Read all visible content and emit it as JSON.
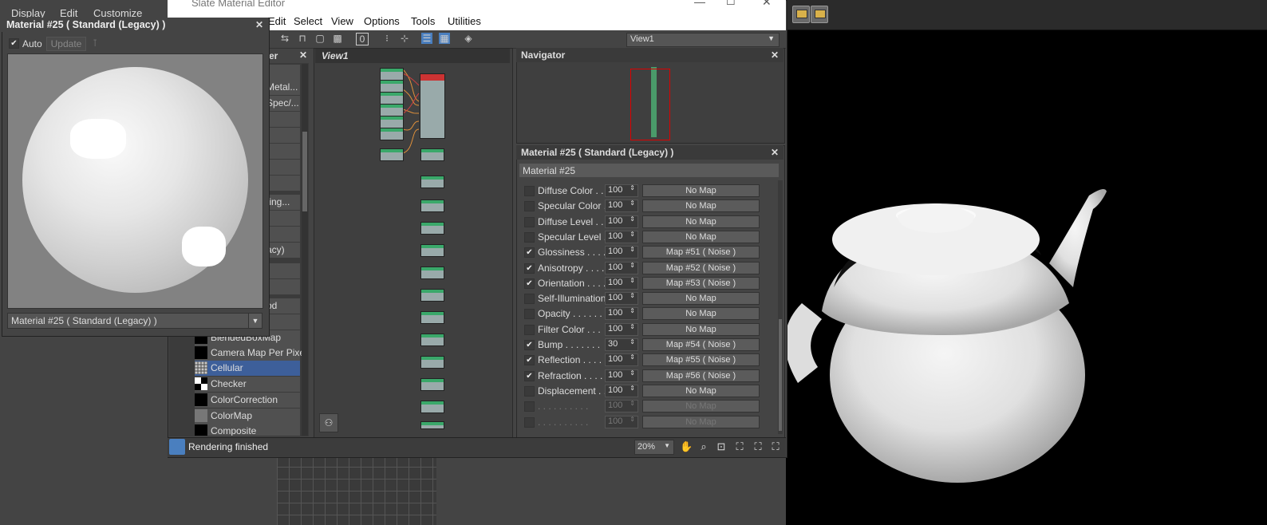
{
  "main_menu": {
    "display": "Display",
    "edit": "Edit",
    "customize": "Customize"
  },
  "slate": {
    "title": "Slate Material Editor",
    "menu": {
      "edit": "Edit",
      "select": "Select",
      "view": "View",
      "options": "Options",
      "tools": "Tools",
      "utilities": "Utilities"
    },
    "view_select": "View1",
    "view_tab": "View1",
    "browser_partial": [
      "er",
      "Metal...",
      "Spec/...",
      "ting...",
      "acy)",
      "od"
    ],
    "browser_items": [
      {
        "label": "BlendedBoxMap",
        "swatch": "#000000"
      },
      {
        "label": "Camera Map Per Pixel",
        "swatch": "#000000"
      },
      {
        "label": "Cellular",
        "swatch": "#888888",
        "selected": true
      },
      {
        "label": "Checker",
        "swatch": "checker"
      },
      {
        "label": "ColorCorrection",
        "swatch": "#000000"
      },
      {
        "label": "ColorMap",
        "swatch": "#777777"
      },
      {
        "label": "Composite",
        "swatch": "#000000"
      }
    ],
    "navigator_title": "Navigator",
    "status": "Rendering finished",
    "zoom": "20%"
  },
  "material": {
    "panel_title": "Material #25  ( Standard (Legacy) )",
    "name": "Material #25",
    "maps": [
      {
        "label": "Diffuse Color . . .",
        "checked": false,
        "amount": "100",
        "map": "No Map"
      },
      {
        "label": "Specular Color  .",
        "checked": false,
        "amount": "100",
        "map": "No Map"
      },
      {
        "label": "Diffuse Level . . .",
        "checked": false,
        "amount": "100",
        "map": "No Map"
      },
      {
        "label": "Specular Level  .",
        "checked": false,
        "amount": "100",
        "map": "No Map"
      },
      {
        "label": "Glossiness  . . . .",
        "checked": true,
        "amount": "100",
        "map": "Map #51  ( Noise )"
      },
      {
        "label": "Anisotropy  . . . .",
        "checked": true,
        "amount": "100",
        "map": "Map #52  ( Noise )"
      },
      {
        "label": "Orientation . . . .",
        "checked": true,
        "amount": "100",
        "map": "Map #53  ( Noise )"
      },
      {
        "label": "Self-Illumination .",
        "checked": false,
        "amount": "100",
        "map": "No Map"
      },
      {
        "label": "Opacity . . . . . .",
        "checked": false,
        "amount": "100",
        "map": "No Map"
      },
      {
        "label": "Filter Color  . . .",
        "checked": false,
        "amount": "100",
        "map": "No Map"
      },
      {
        "label": "Bump  . . . . . . .",
        "checked": true,
        "amount": "30",
        "map": "Map #54  ( Noise )"
      },
      {
        "label": "Reflection  . . . .",
        "checked": true,
        "amount": "100",
        "map": "Map #55  ( Noise )"
      },
      {
        "label": "Refraction  . . . .",
        "checked": true,
        "amount": "100",
        "map": "Map #56  ( Noise )"
      },
      {
        "label": "Displacement  . . .",
        "checked": false,
        "amount": "100",
        "map": "No Map"
      },
      {
        "label": ". . . . . . . . . .",
        "checked": false,
        "amount": "100",
        "map": "No Map",
        "disabled": true
      },
      {
        "label": ". . . . . . . . . .",
        "checked": false,
        "amount": "100",
        "map": "No Map",
        "disabled": true
      }
    ]
  },
  "preview": {
    "title": "Material #25  ( Standard (Legacy) )",
    "auto_label": "Auto",
    "update_label": "Update",
    "dropdown": "Material #25  ( Standard (Legacy) )"
  }
}
